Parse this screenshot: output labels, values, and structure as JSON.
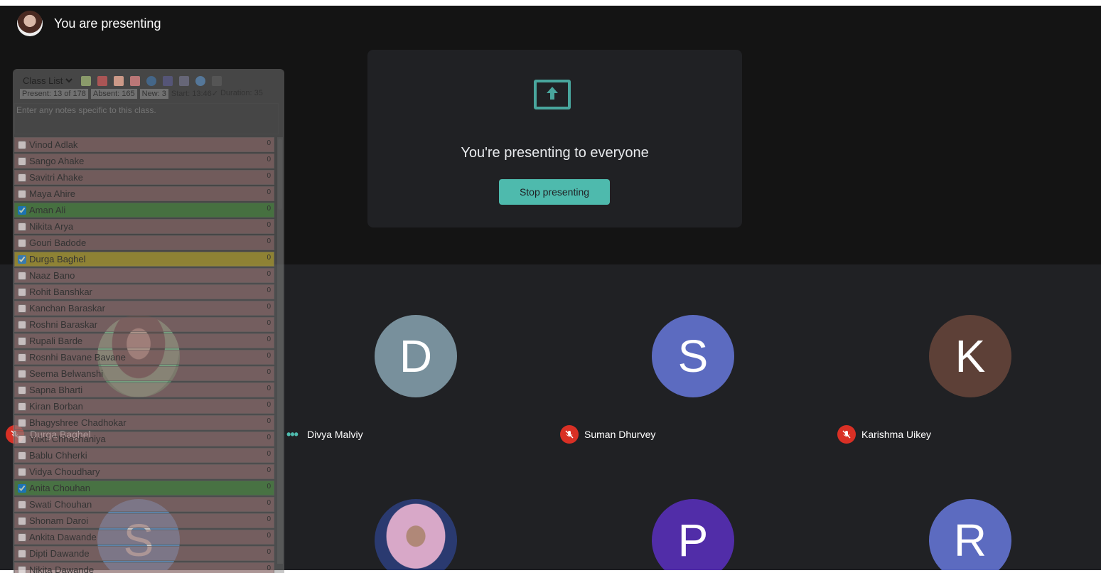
{
  "presenter": {
    "status_text": "You are presenting"
  },
  "present_card": {
    "title": "You're presenting to everyone",
    "stop_label": "Stop presenting"
  },
  "participants": [
    {
      "name": "Durga Baghel",
      "initial": "",
      "color": "",
      "photo": "photo1",
      "mic": "muted"
    },
    {
      "name": "Divya Malviy",
      "initial": "D",
      "color": "#78909c",
      "mic": "speaking"
    },
    {
      "name": "Suman Dhurvey",
      "initial": "S",
      "color": "#5c6bc0",
      "mic": "muted"
    },
    {
      "name": "Karishma Uikey",
      "initial": "K",
      "color": "#5d4037",
      "mic": "muted"
    },
    {
      "name": "",
      "initial": "S",
      "color": "#3f82c4"
    },
    {
      "name": "",
      "initial": "",
      "color": "",
      "photo": "photo2"
    },
    {
      "name": "",
      "initial": "P",
      "color": "#512da8"
    },
    {
      "name": "",
      "initial": "R",
      "color": "#5c6bc0"
    }
  ],
  "class_panel": {
    "select_label": "Class List",
    "present": "Present: 13 of 178",
    "absent": "Absent: 165",
    "new": "New: 3",
    "start": "Start: 13:46✓",
    "duration": "Duration: 35",
    "notes_placeholder": "Enter any notes specific to this class.",
    "students": [
      {
        "name": "Vinod Adlak",
        "state": "none"
      },
      {
        "name": "Sango Ahake",
        "state": "none"
      },
      {
        "name": "Savitri Ahake",
        "state": "none"
      },
      {
        "name": "Maya Ahire",
        "state": "none"
      },
      {
        "name": "Aman Ali",
        "state": "green"
      },
      {
        "name": "Nikita Arya",
        "state": "none"
      },
      {
        "name": "Gouri Badode",
        "state": "none"
      },
      {
        "name": "Durga Baghel",
        "state": "yellow"
      },
      {
        "name": "Naaz Bano",
        "state": "none"
      },
      {
        "name": "Rohit Banshkar",
        "state": "none"
      },
      {
        "name": "Kanchan Baraskar",
        "state": "none"
      },
      {
        "name": "Roshni Baraskar",
        "state": "none"
      },
      {
        "name": "Rupali Barde",
        "state": "none"
      },
      {
        "name": "Rosnhi Bavane Bavane",
        "state": "none"
      },
      {
        "name": "Seema Belwanshi",
        "state": "none"
      },
      {
        "name": "Sapna Bharti",
        "state": "none"
      },
      {
        "name": "Kiran Borban",
        "state": "none"
      },
      {
        "name": "Bhagyshree Chadhokar",
        "state": "none"
      },
      {
        "name": "Yukti Chhachaniya",
        "state": "none"
      },
      {
        "name": "Bablu Chherki",
        "state": "none"
      },
      {
        "name": "Vidya Choudhary",
        "state": "none"
      },
      {
        "name": "Anita Chouhan",
        "state": "green"
      },
      {
        "name": "Swati Chouhan",
        "state": "none"
      },
      {
        "name": "Shonam Daroi",
        "state": "none"
      },
      {
        "name": "Ankita Dawande",
        "state": "none"
      },
      {
        "name": "Dipti Dawande",
        "state": "none"
      },
      {
        "name": "Nikita Dawande",
        "state": "none"
      }
    ],
    "phone_count": "0"
  },
  "colors": {
    "accent": "#4ebaad",
    "mute": "#d93025",
    "bg_top": "#141414",
    "bg_grid": "#202124"
  }
}
